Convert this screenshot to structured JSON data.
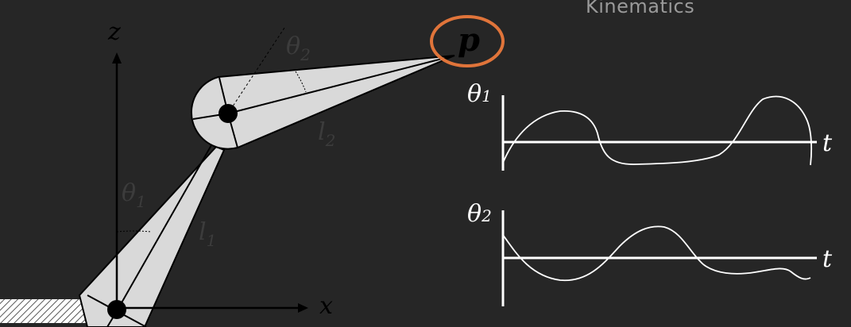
{
  "title": "Kinematics",
  "arm": {
    "axis_z": "z",
    "axis_x": "x",
    "theta1": "θ",
    "theta1_sub": "1",
    "theta2": "θ",
    "theta2_sub": "2",
    "link1": "l",
    "link1_sub": "1",
    "link2": "l",
    "link2_sub": "2",
    "end_effector": "p"
  },
  "plots": {
    "theta1_label": "θ",
    "theta1_sub": "1",
    "theta2_label": "θ",
    "theta2_sub": "2",
    "t_label_1": "t",
    "t_label_2": "t"
  },
  "colors": {
    "background": "#262626",
    "link_fill": "#d9d9d9",
    "highlight": "#e0743a",
    "ink": "#ffffff",
    "faint_text": "#3c3c3c"
  }
}
